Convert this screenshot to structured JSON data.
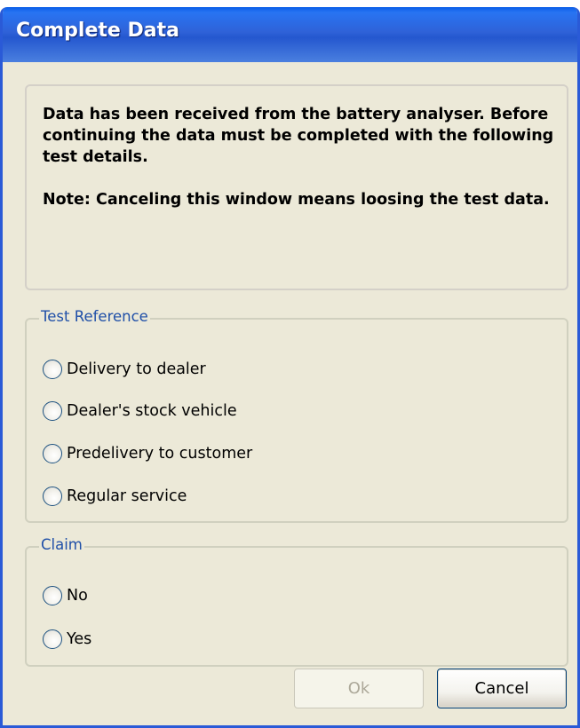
{
  "window": {
    "title": "Complete Data"
  },
  "message": {
    "line_block_1": "Data has been received from the battery analyser. Before continuing the data must be completed with the following test details.",
    "line_block_2": "Note: Canceling this window means loosing the test data."
  },
  "test_reference": {
    "legend": "Test Reference",
    "options": [
      {
        "label": "Delivery to dealer",
        "checked": false
      },
      {
        "label": "Dealer's stock vehicle",
        "checked": false
      },
      {
        "label": "Predelivery to customer",
        "checked": false
      },
      {
        "label": "Regular service",
        "checked": false
      }
    ]
  },
  "claim": {
    "legend": "Claim",
    "options": [
      {
        "label": "No",
        "checked": false
      },
      {
        "label": "Yes",
        "checked": false
      }
    ]
  },
  "buttons": {
    "ok_label": "Ok",
    "ok_enabled": false,
    "cancel_label": "Cancel",
    "cancel_enabled": true
  },
  "colors": {
    "titlebar": "#2457cf",
    "dialog_background": "#ece9d8",
    "groupbox_legend": "#2050a8"
  }
}
